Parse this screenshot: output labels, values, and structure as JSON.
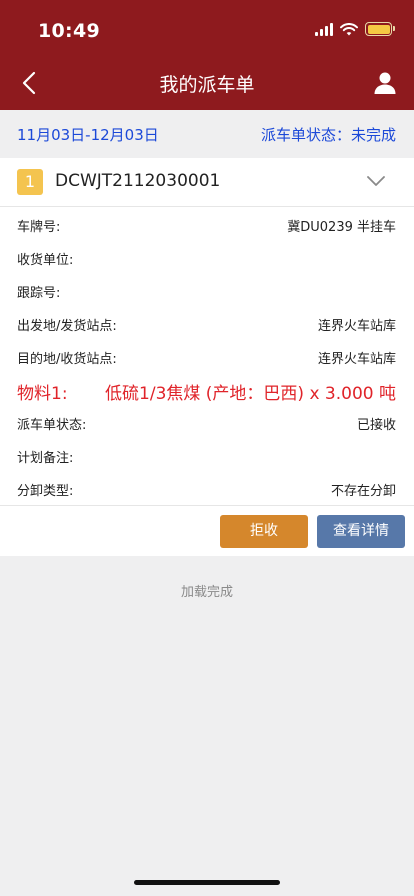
{
  "status_bar": {
    "time": "10:49"
  },
  "nav": {
    "title": "我的派车单"
  },
  "filter": {
    "date_range": "11月03日-12月03日",
    "status": "派车单状态：未完成"
  },
  "order": {
    "index": "1",
    "code": "DCWJT2112030001",
    "fields": [
      {
        "label": "车牌号:",
        "value": "冀DU0239 半挂车"
      },
      {
        "label": "收货单位:",
        "value": ""
      },
      {
        "label": "跟踪号:",
        "value": ""
      },
      {
        "label": "出发地/发货站点:",
        "value": "连界火车站库"
      },
      {
        "label": "目的地/收货站点:",
        "value": "连界火车站库"
      }
    ],
    "material": {
      "label": "物料1:",
      "value": "低硫1/3焦煤 (产地：巴西) x 3.000 吨"
    },
    "fields2": [
      {
        "label": "派车单状态:",
        "value": "已接收"
      },
      {
        "label": "计划备注:",
        "value": ""
      },
      {
        "label": "分卸类型:",
        "value": "不存在分卸"
      }
    ],
    "buttons": {
      "reject": "拒收",
      "detail": "查看详情"
    }
  },
  "footer": {
    "load_status": "加载完成"
  },
  "colors": {
    "header": "#8e1a1e",
    "accent_blue": "#1c49d8",
    "material_red": "#e0242a",
    "reject": "#d5872c",
    "detail": "#5778a9",
    "badge": "#f4c44f"
  },
  "icons": [
    "signal-icon",
    "wifi-icon",
    "battery-icon",
    "back-arrow-icon",
    "user-icon",
    "chevron-down-icon"
  ]
}
